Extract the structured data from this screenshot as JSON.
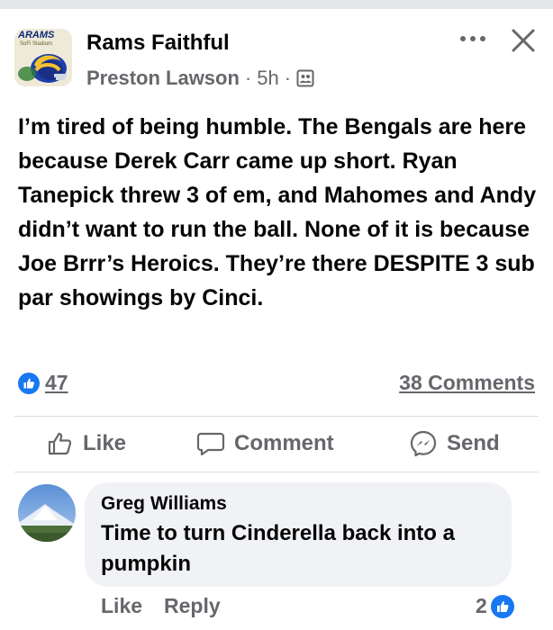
{
  "post": {
    "group_name": "Rams Faithful",
    "author": "Preston Lawson",
    "separator": "·",
    "time": "5h",
    "avatar_text_top": "ARAMS",
    "avatar_text_sub": "SoFi Stadium",
    "body": "I’m tired of being humble. The Bengals are here because Derek Carr came up short. Ryan Tanepick threw 3 of em, and Mahomes and Andy didn’t want to run the ball. None of it is because Joe Brrr’s Heroics. They’re there DESPITE 3 sub par showings by Cinci."
  },
  "stats": {
    "reactions": "47",
    "comments": "38 Comments"
  },
  "actions": {
    "like": "Like",
    "comment": "Comment",
    "send": "Send"
  },
  "comment": {
    "name": "Greg Williams",
    "text": "Time to turn Cinderella back into a pumpkin",
    "like": "Like",
    "reply": "Reply",
    "reactions": "2"
  },
  "icons": {
    "more": "more-icon",
    "close": "close-icon",
    "members": "members-icon",
    "like": "thumbs-up-icon",
    "comment": "speech-bubble-icon",
    "send": "messenger-icon"
  },
  "colors": {
    "accent": "#1877f2",
    "secondary_text": "#65676b",
    "bubble": "#f0f2f5"
  }
}
